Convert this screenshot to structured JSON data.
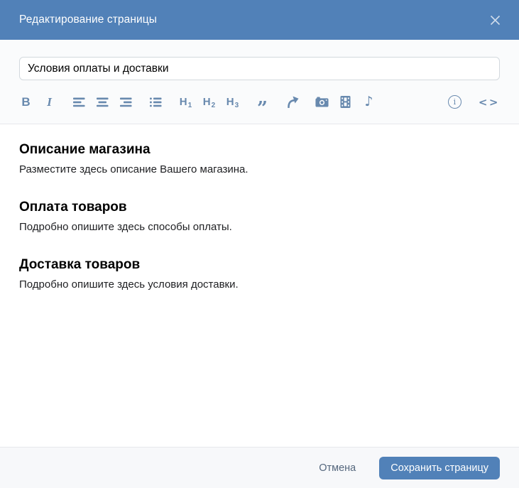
{
  "window": {
    "title": "Редактирование страницы"
  },
  "title_input": {
    "value": "Условия оплаты и доставки"
  },
  "toolbar": {
    "bold_label": "B",
    "italic_label": "I",
    "heading_letter": "H",
    "h1_sub": "1",
    "h2_sub": "2",
    "h3_sub": "3",
    "quote_glyph": "”",
    "music_glyph": "♪",
    "info_glyph": "i",
    "code_glyph": "<>"
  },
  "content": {
    "sections": [
      {
        "heading": "Описание магазина",
        "text": "Разместите здесь описание Вашего магазина."
      },
      {
        "heading": "Оплата товаров",
        "text": "Подробно опишите здесь способы оплаты."
      },
      {
        "heading": "Доставка товаров",
        "text": "Подробно опишите здесь условия доставки."
      }
    ]
  },
  "footer": {
    "cancel_label": "Отмена",
    "save_label": "Сохранить страницу"
  },
  "colors": {
    "header_bg": "#5181b8",
    "primary_button_bg": "#5181b8",
    "toolbar_icon": "#6889ae",
    "footer_bg": "#f7f8fa",
    "border": "#e7e8ec",
    "cancel_link": "#55677d",
    "input_border": "#d3d9de"
  }
}
